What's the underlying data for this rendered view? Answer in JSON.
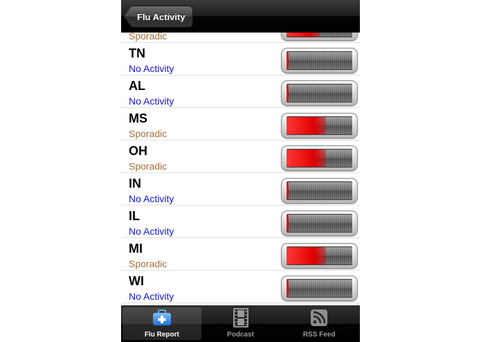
{
  "navbar": {
    "back_label": "Flu Activity"
  },
  "colors": {
    "sporadic": "#a0703a",
    "no_activity": "#1414d6",
    "meter_fill": "#e00000",
    "active_tab_icon": "#3a8fe8"
  },
  "rows": [
    {
      "state": "",
      "status": "Sporadic",
      "level": 0.5,
      "kind": "sporadic"
    },
    {
      "state": "TN",
      "status": "No Activity",
      "level": 0.05,
      "kind": "none"
    },
    {
      "state": "AL",
      "status": "No Activity",
      "level": 0.05,
      "kind": "none"
    },
    {
      "state": "MS",
      "status": "Sporadic",
      "level": 0.6,
      "kind": "sporadic"
    },
    {
      "state": "OH",
      "status": "Sporadic",
      "level": 0.6,
      "kind": "sporadic"
    },
    {
      "state": "IN",
      "status": "No Activity",
      "level": 0.05,
      "kind": "none"
    },
    {
      "state": "IL",
      "status": "No Activity",
      "level": 0.05,
      "kind": "none"
    },
    {
      "state": "MI",
      "status": "Sporadic",
      "level": 0.6,
      "kind": "sporadic"
    },
    {
      "state": "WI",
      "status": "No Activity",
      "level": 0.05,
      "kind": "none"
    }
  ],
  "tabs": [
    {
      "label": "Flu Report",
      "icon": "medical-kit-icon",
      "active": true
    },
    {
      "label": "Podcast",
      "icon": "film-strip-icon",
      "active": false
    },
    {
      "label": "RSS Feed",
      "icon": "rss-icon",
      "active": false
    }
  ]
}
